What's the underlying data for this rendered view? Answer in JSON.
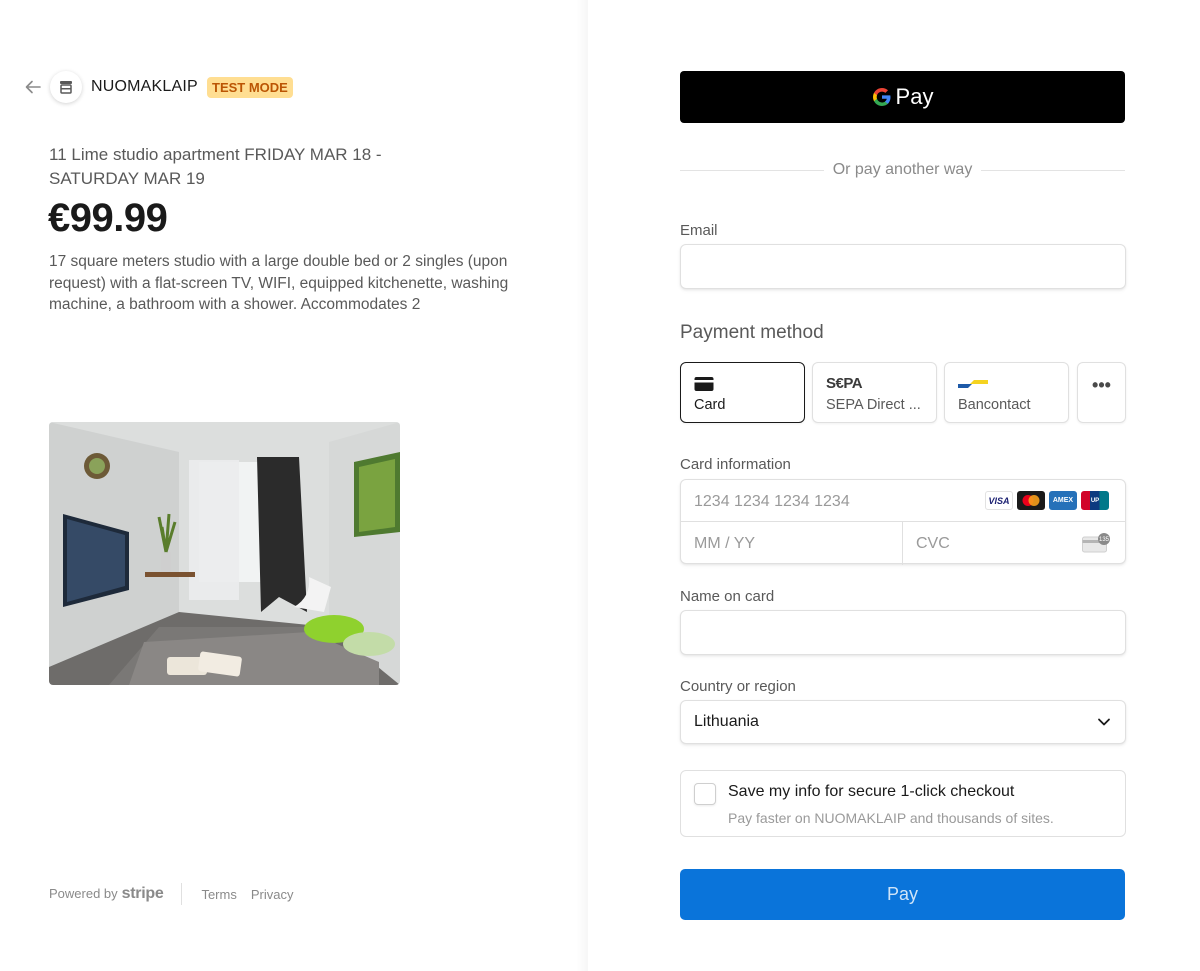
{
  "merchant": {
    "name": "NUOMAKLAIP",
    "test_badge": "TEST MODE"
  },
  "product": {
    "title": "11 Lime studio apartment FRIDAY MAR 18 - SATURDAY MAR 19",
    "price": "€99.99",
    "description": "17 square meters studio with a large double bed or 2 singles (upon request) with a flat-screen TV, WIFI, equipped kitchenette, washing machine, a bathroom with a shower. Accommodates 2"
  },
  "footer": {
    "powered_by": "Powered by",
    "stripe": "stripe",
    "terms": "Terms",
    "privacy": "Privacy"
  },
  "gpay": {
    "label": "Pay"
  },
  "divider": {
    "text": "Or pay another way"
  },
  "email": {
    "label": "Email",
    "value": ""
  },
  "payment_method": {
    "title": "Payment method",
    "tabs": [
      {
        "label": "Card",
        "selected": true,
        "icon": "card-icon"
      },
      {
        "label": "SEPA Direct ...",
        "selected": false,
        "icon": "sepa-logo",
        "logo_text": "S€PA"
      },
      {
        "label": "Bancontact",
        "selected": false,
        "icon": "bancontact-logo"
      }
    ],
    "more": "•••"
  },
  "card": {
    "label": "Card information",
    "number_placeholder": "1234 1234 1234 1234",
    "expiry_placeholder": "MM / YY",
    "cvc_placeholder": "CVC",
    "brands": [
      {
        "name": "VISA",
        "icon": "visa-icon"
      },
      {
        "name": "mastercard",
        "icon": "mastercard-icon"
      },
      {
        "name": "AMEX",
        "icon": "amex-icon"
      },
      {
        "name": "UnionPay",
        "icon": "unionpay-icon"
      }
    ],
    "cvc_hint": "135"
  },
  "name_on_card": {
    "label": "Name on card",
    "value": ""
  },
  "country": {
    "label": "Country or region",
    "value": "Lithuania"
  },
  "save_info": {
    "title": "Save my info for secure 1-click checkout",
    "subtitle": "Pay faster on NUOMAKLAIP and thousands of sites.",
    "checked": false
  },
  "pay_button": {
    "label": "Pay"
  },
  "colors": {
    "pay_button": "#0a74da",
    "test_badge_bg": "#ffde92",
    "test_badge_text": "#bb5504"
  }
}
